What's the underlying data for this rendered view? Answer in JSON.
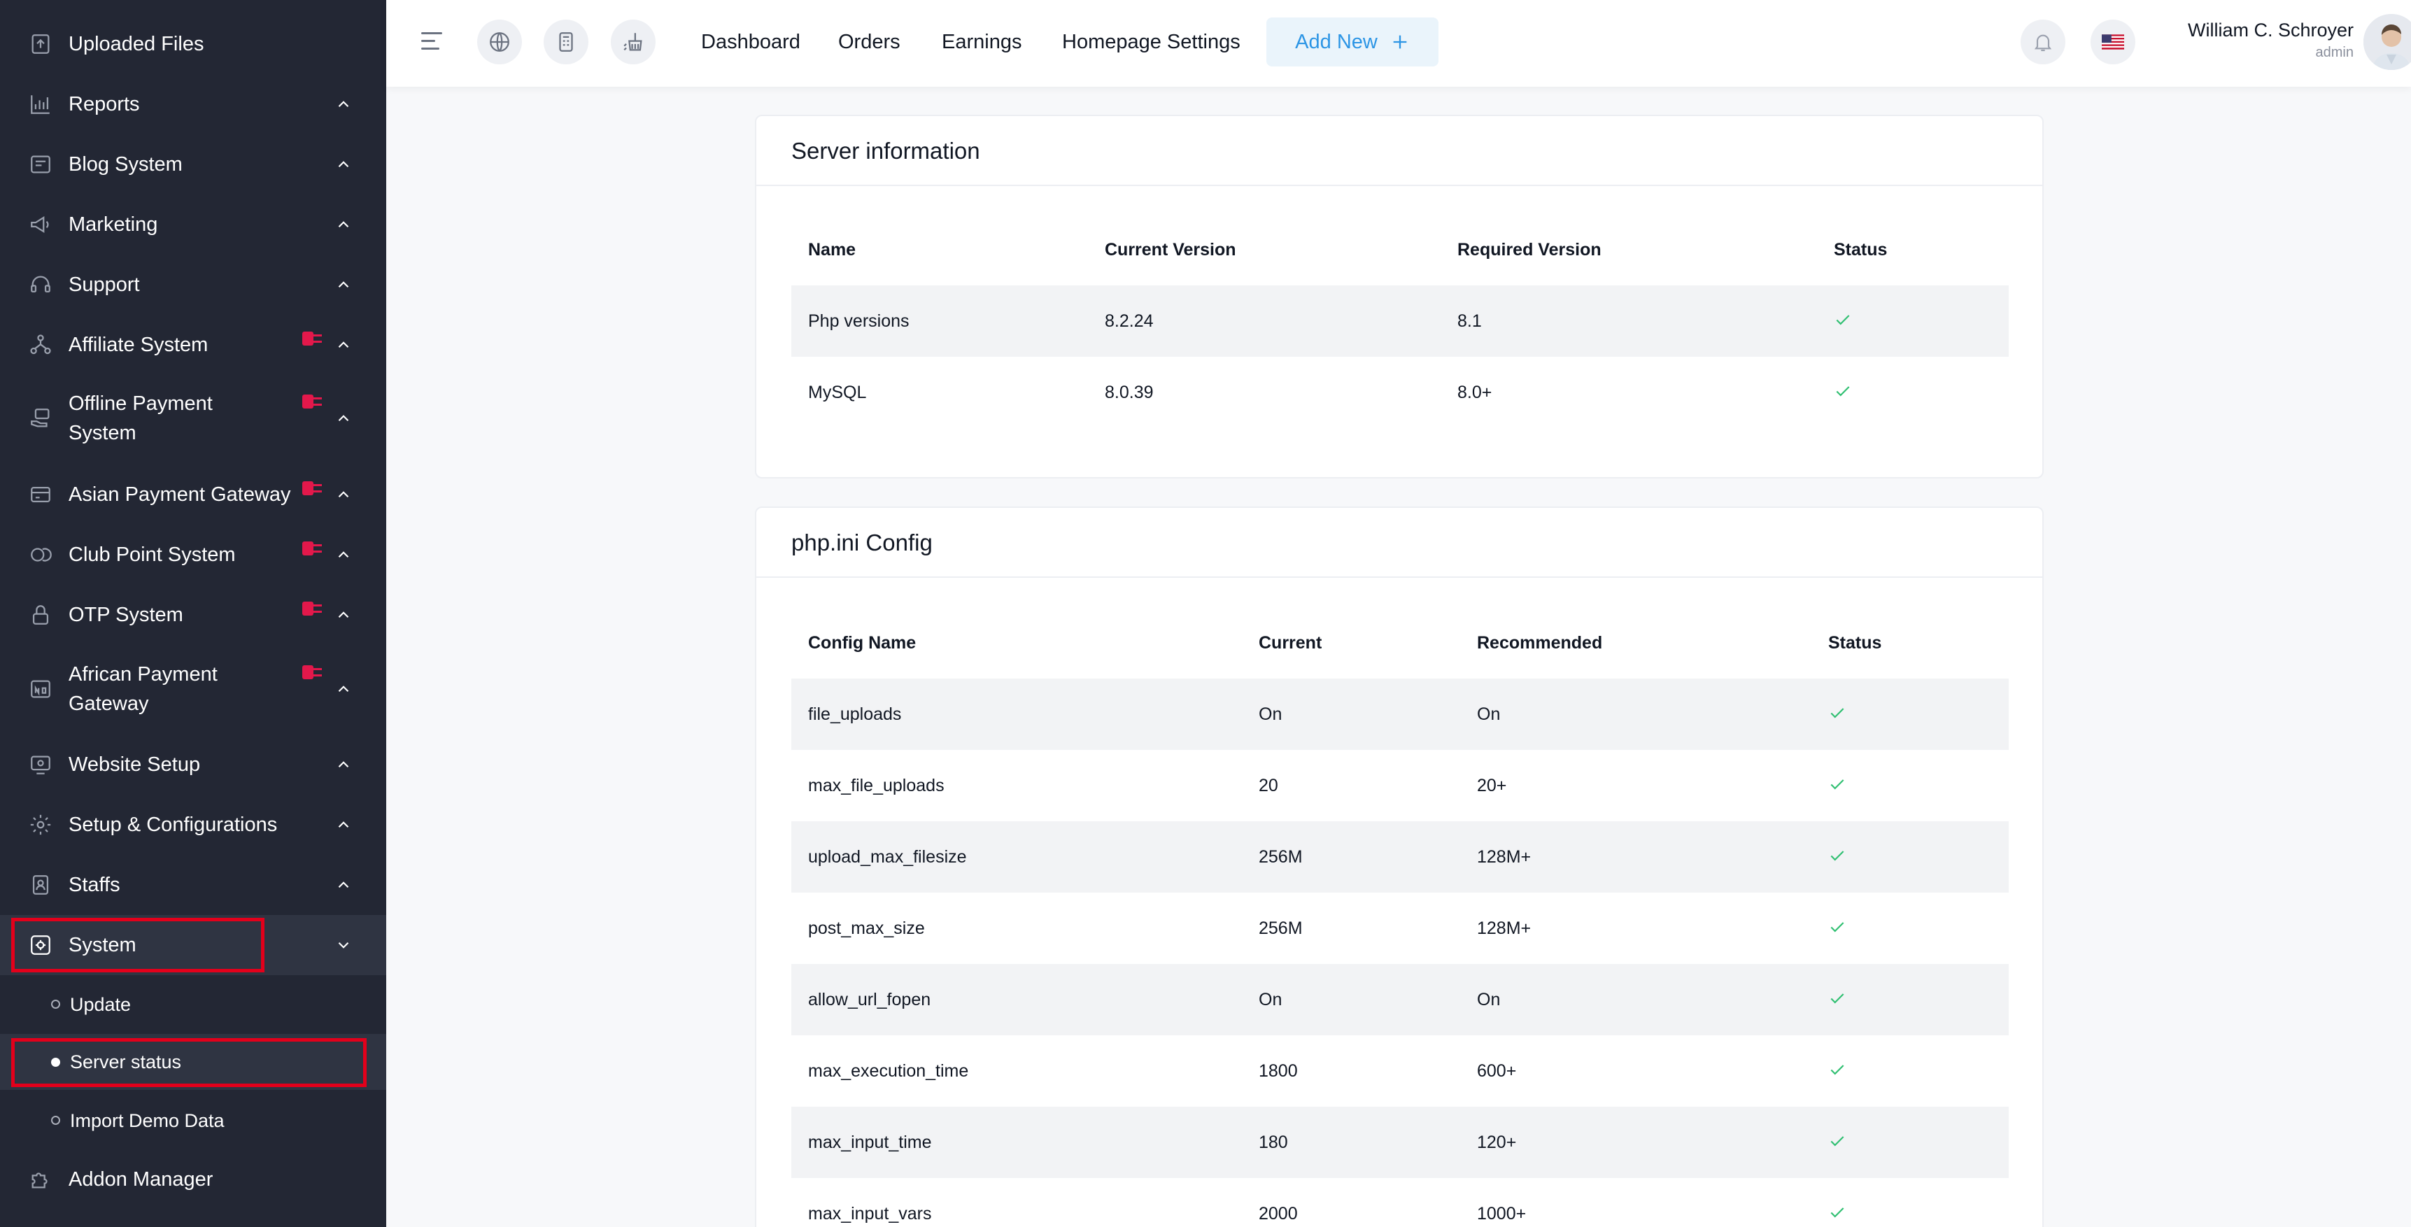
{
  "sidebar": {
    "items": [
      {
        "label": "Uploaded Files"
      },
      {
        "label": "Reports"
      },
      {
        "label": "Blog System"
      },
      {
        "label": "Marketing"
      },
      {
        "label": "Support"
      },
      {
        "label": "Affiliate System"
      },
      {
        "label": "Offline Payment",
        "label2": "System"
      },
      {
        "label": "Asian Payment Gateway"
      },
      {
        "label": "Club Point System"
      },
      {
        "label": "OTP System"
      },
      {
        "label": "African Payment",
        "label2": "Gateway"
      },
      {
        "label": "Website Setup"
      },
      {
        "label": "Setup & Configurations"
      },
      {
        "label": "Staffs"
      },
      {
        "label": "System"
      },
      {
        "label": "Addon Manager"
      }
    ],
    "system_sub": [
      {
        "label": "Update"
      },
      {
        "label": "Server status"
      },
      {
        "label": "Import Demo Data"
      }
    ]
  },
  "topbar": {
    "links": [
      "Dashboard",
      "Orders",
      "Earnings",
      "Homepage Settings"
    ],
    "add_new": "Add New",
    "user_name": "William C. Schroyer",
    "user_role": "admin"
  },
  "server_info": {
    "title": "Server information",
    "headers": [
      "Name",
      "Current Version",
      "Required Version",
      "Status"
    ],
    "rows": [
      {
        "name": "Php versions",
        "current": "8.2.24",
        "required": "8.1",
        "status": "ok"
      },
      {
        "name": "MySQL",
        "current": "8.0.39",
        "required": "8.0+",
        "status": "ok"
      }
    ]
  },
  "php_config": {
    "title": "php.ini Config",
    "headers": [
      "Config Name",
      "Current",
      "Recommended",
      "Status"
    ],
    "rows": [
      {
        "name": "file_uploads",
        "current": "On",
        "recommended": "On",
        "status": "ok"
      },
      {
        "name": "max_file_uploads",
        "current": "20",
        "recommended": "20+",
        "status": "ok"
      },
      {
        "name": "upload_max_filesize",
        "current": "256M",
        "recommended": "128M+",
        "status": "ok"
      },
      {
        "name": "post_max_size",
        "current": "256M",
        "recommended": "128M+",
        "status": "ok"
      },
      {
        "name": "allow_url_fopen",
        "current": "On",
        "recommended": "On",
        "status": "ok"
      },
      {
        "name": "max_execution_time",
        "current": "1800",
        "recommended": "600+",
        "status": "ok"
      },
      {
        "name": "max_input_time",
        "current": "180",
        "recommended": "120+",
        "status": "ok"
      },
      {
        "name": "max_input_vars",
        "current": "2000",
        "recommended": "1000+",
        "status": "ok"
      }
    ]
  },
  "colors": {
    "sidebar_bg": "#232734",
    "accent": "#2c95e5",
    "success": "#2fbf71",
    "addon_badge": "#e3184b",
    "highlight_border": "#e3001b"
  }
}
